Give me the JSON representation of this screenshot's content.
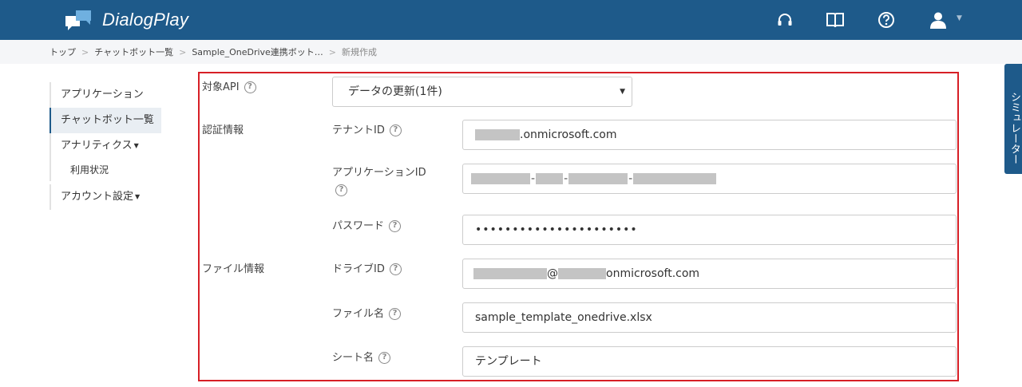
{
  "app": {
    "name": "DialogPlay"
  },
  "header_icons": [
    "headset-icon",
    "book-icon",
    "help-circle-icon",
    "user-icon"
  ],
  "breadcrumb": {
    "items": [
      "トップ",
      "チャットボット一覧",
      "Sample_OneDrive連携ボット…"
    ],
    "current": "新規作成"
  },
  "sidebar": {
    "items": [
      {
        "label": "アプリケーション"
      },
      {
        "label": "チャットボット一覧"
      },
      {
        "label": "アナリティクス"
      },
      {
        "label": "利用状況"
      },
      {
        "label": "アカウント設定"
      }
    ]
  },
  "simulator": {
    "label": "シミュレーター"
  },
  "form": {
    "target_api": {
      "label": "対象API",
      "selected": "データの更新(1件)"
    },
    "auth_section": "認証情報",
    "tenant_id": {
      "label": "テナントID",
      "value": ".onmicrosoft.com"
    },
    "application_id": {
      "label": "アプリケーションID",
      "separator": "-"
    },
    "password": {
      "label": "パスワード",
      "value": "••••••••••••••••••••••"
    },
    "file_section": "ファイル情報",
    "drive_id": {
      "label": "ドライブID",
      "at": "@",
      "value": "onmicrosoft.com"
    },
    "file_name": {
      "label": "ファイル名",
      "value": "sample_template_onedrive.xlsx"
    },
    "sheet_name": {
      "label": "シート名",
      "value": "テンプレート"
    },
    "help_glyph": "?"
  }
}
